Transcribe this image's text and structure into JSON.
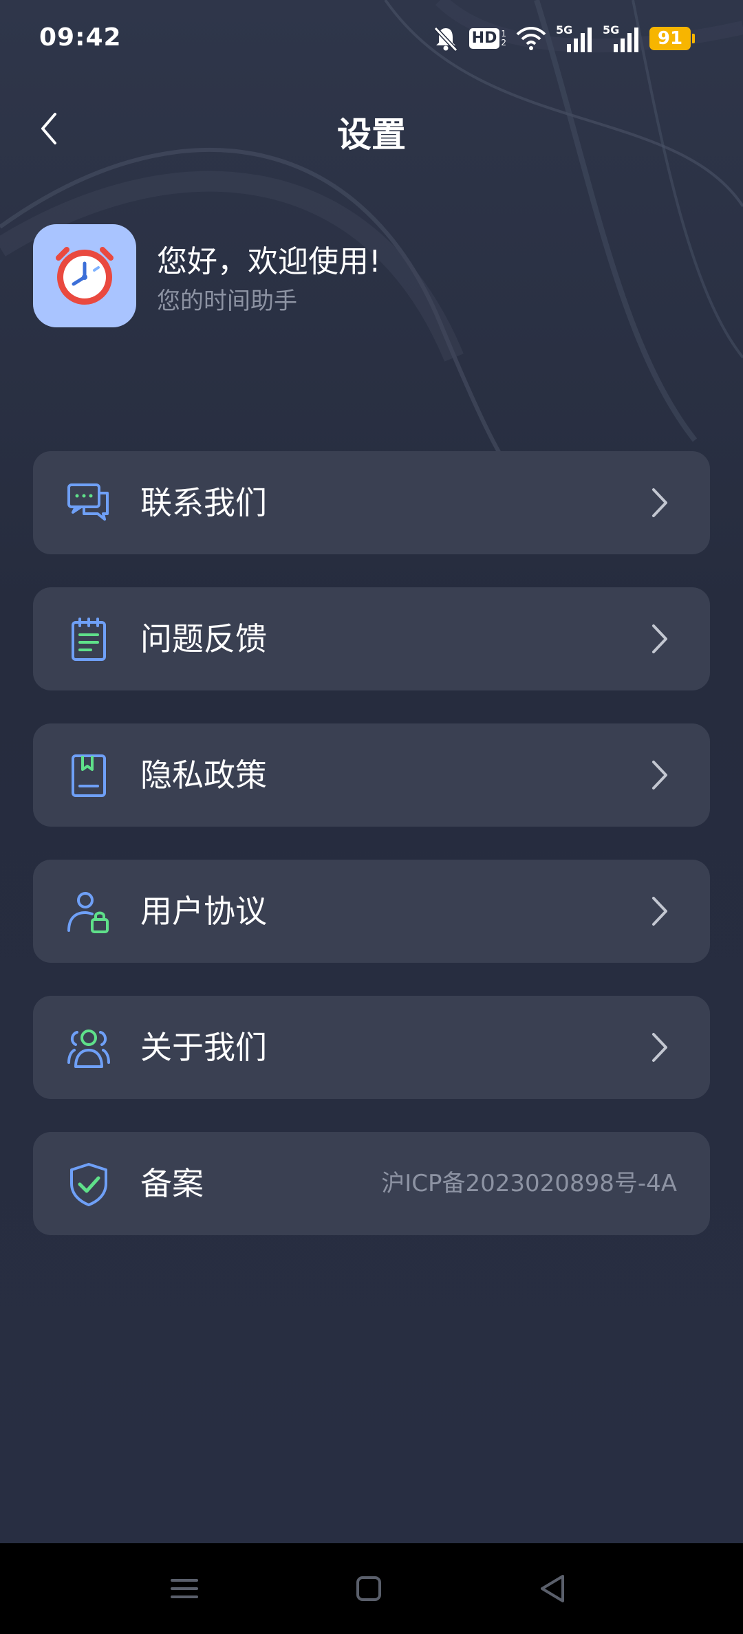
{
  "status_bar": {
    "time": "09:42",
    "battery": "91",
    "hd_label": "HD",
    "network_1": "5G",
    "network_2": "5G",
    "icons": [
      "mute-bell-icon",
      "hd-icon",
      "wifi-icon",
      "signal-icon",
      "signal-icon",
      "battery-icon"
    ]
  },
  "header": {
    "title": "设置",
    "back_icon": "chevron-left-icon"
  },
  "profile": {
    "greeting": "您好，欢迎使用!",
    "subtitle": "您的时间助手",
    "app_icon": "alarm-clock-icon"
  },
  "menu": {
    "items": [
      {
        "label": "联系我们",
        "icon": "chat-bubbles-icon"
      },
      {
        "label": "问题反馈",
        "icon": "notepad-icon"
      },
      {
        "label": "隐私政策",
        "icon": "bookmark-document-icon"
      },
      {
        "label": "用户协议",
        "icon": "user-lock-icon"
      },
      {
        "label": "关于我们",
        "icon": "users-icon"
      }
    ],
    "record": {
      "label": "备案",
      "value": "沪ICP备2023020898号-4A",
      "icon": "shield-check-icon"
    }
  },
  "nav_bar": {
    "buttons": [
      "menu-icon",
      "home-square-icon",
      "back-triangle-icon"
    ]
  },
  "colors": {
    "background": "#262d40",
    "card": "#3a4052",
    "accent_blue": "#6fa0f7",
    "accent_green": "#5fe08a",
    "battery": "#f7b500"
  }
}
